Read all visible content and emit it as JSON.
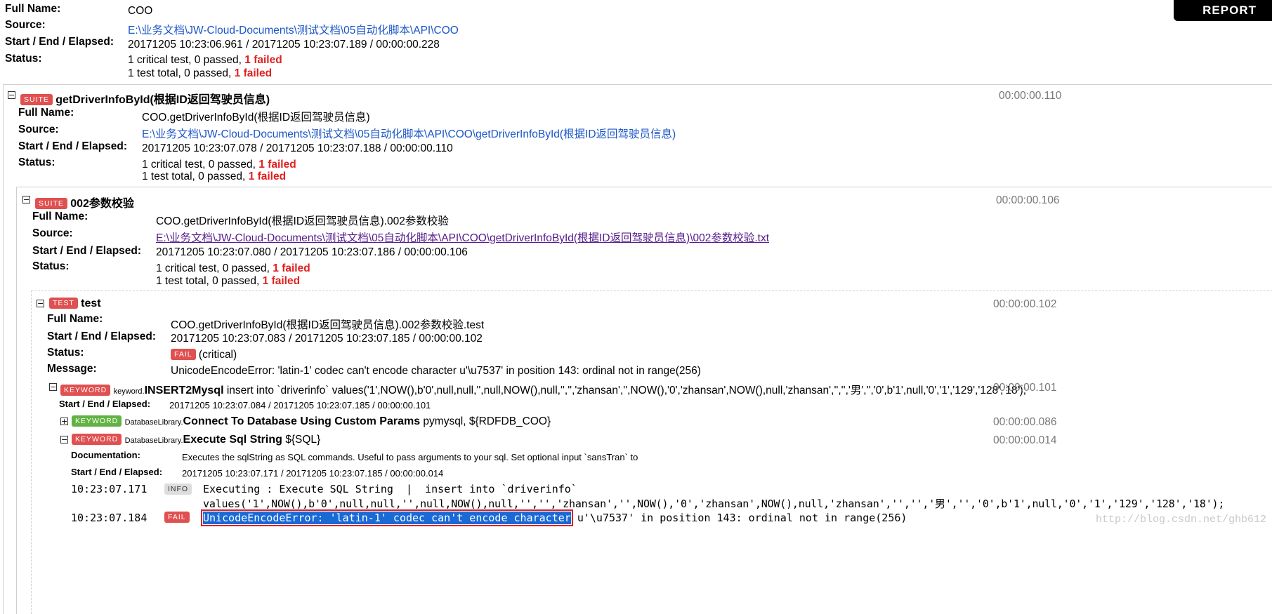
{
  "header": {
    "report_label": "REPORT",
    "full_name_label": "Full Name:",
    "full_name": "COO",
    "source_label": "Source:",
    "source": "E:\\业务文档\\JW-Cloud-Documents\\测试文档\\05自动化脚本\\API\\COO",
    "time_label": "Start / End / Elapsed:",
    "time": "20171205 10:23:06.961 / 20171205 10:23:07.189 / 00:00:00.228",
    "status_label": "Status:",
    "status_line1_prefix": "1 critical test, 0 passed, ",
    "status_line1_fail": "1 failed",
    "status_line2_prefix": "1 test total, 0 passed, ",
    "status_line2_fail": "1 failed"
  },
  "suite1": {
    "toggle": "−",
    "badge": "SUITE",
    "name": "getDriverInfoById(根据ID返回驾驶员信息)",
    "elapsed": "00:00:00.110",
    "full_name_label": "Full Name:",
    "full_name": "COO.getDriverInfoById(根据ID返回驾驶员信息)",
    "source_label": "Source:",
    "source": "E:\\业务文档\\JW-Cloud-Documents\\测试文档\\05自动化脚本\\API\\COO\\getDriverInfoById(根据ID返回驾驶员信息)",
    "time_label": "Start / End / Elapsed:",
    "time": "20171205 10:23:07.078 / 20171205 10:23:07.188 / 00:00:00.110",
    "status_label": "Status:",
    "status_line1_prefix": "1 critical test, 0 passed, ",
    "status_line1_fail": "1 failed",
    "status_line2_prefix": "1 test total, 0 passed, ",
    "status_line2_fail": "1 failed"
  },
  "suite2": {
    "toggle": "−",
    "badge": "SUITE",
    "name": "002参数校验",
    "elapsed": "00:00:00.106",
    "full_name_label": "Full Name:",
    "full_name": "COO.getDriverInfoById(根据ID返回驾驶员信息).002参数校验",
    "source_label": "Source:",
    "source": "E:\\业务文档\\JW-Cloud-Documents\\测试文档\\05自动化脚本\\API\\COO\\getDriverInfoById(根据ID返回驾驶员信息)\\002参数校验.txt",
    "time_label": "Start / End / Elapsed:",
    "time": "20171205 10:23:07.080 / 20171205 10:23:07.186 / 00:00:00.106",
    "status_label": "Status:",
    "status_line1_prefix": "1 critical test, 0 passed, ",
    "status_line1_fail": "1 failed",
    "status_line2_prefix": "1 test total, 0 passed, ",
    "status_line2_fail": "1 failed"
  },
  "test": {
    "toggle": "−",
    "badge": "TEST",
    "name": "test",
    "elapsed": "00:00:00.102",
    "full_name_label": "Full Name:",
    "full_name": "COO.getDriverInfoById(根据ID返回驾驶员信息).002参数校验.test",
    "time_label": "Start / End / Elapsed:",
    "time": "20171205 10:23:07.083 / 20171205 10:23:07.185 / 00:00:00.102",
    "status_label": "Status:",
    "status_badge": "FAIL",
    "status_text": "(critical)",
    "message_label": "Message:",
    "message": "UnicodeEncodeError: 'latin-1' codec can't encode character u'\\u7537' in position 143: ordinal not in range(256)"
  },
  "kw1": {
    "toggle": "−",
    "badge": "KEYWORD",
    "lib": "keyword.",
    "name": "INSERT2Mysql",
    "args": "insert into `driverinfo` values('1',NOW(),b'0',null,null,'',null,NOW(),null,'','','zhansan','',NOW(),'0','zhansan',NOW(),null,'zhansan','','','男','','0',b'1',null,'0','1','129','128','18');",
    "elapsed": "00:00:00.101",
    "time_label": "Start / End / Elapsed:",
    "time": "20171205 10:23:07.084 / 20171205 10:23:07.185 / 00:00:00.101"
  },
  "kw2": {
    "toggle": "+",
    "badge": "KEYWORD",
    "lib": "DatabaseLibrary.",
    "name": "Connect To Database Using Custom Params",
    "args": "pymysql, ${RDFDB_COO}",
    "elapsed": "00:00:00.086"
  },
  "kw3": {
    "toggle": "−",
    "badge": "KEYWORD",
    "lib": "DatabaseLibrary.",
    "name": "Execute Sql String",
    "args": "${SQL}",
    "elapsed": "00:00:00.014",
    "doc_label": "Documentation:",
    "doc": "Executes the sqlString as SQL commands. Useful to pass arguments to your sql. Set optional input `sansTran` to",
    "time_label": "Start / End / Elapsed:",
    "time": "20171205 10:23:07.171 / 20171205 10:23:07.185 / 00:00:00.014"
  },
  "log": [
    {
      "timestamp": "10:23:07.171",
      "level": "INFO",
      "line1": "Executing : Execute SQL String  |  insert into `driverinfo`",
      "line2": "values('1',NOW(),b'0',null,null,'',null,NOW(),null,'','','zhansan','',NOW(),'0','zhansan',NOW(),null,'zhansan','','','男','','0',b'1',null,'0','1','129','128','18');"
    },
    {
      "timestamp": "10:23:07.184",
      "level": "FAIL",
      "selected_text": "UnicodeEncodeError: 'latin-1' codec can't encode character",
      "rest_text": " u'\\u7537' in position 143: ordinal not in range(256)"
    }
  ],
  "watermark": "http://blog.csdn.net/ghb612",
  "colors": {
    "fail_red": "#e02020",
    "badge_red": "#e05050",
    "badge_green": "#61b243",
    "link_blue": "#1a55c8"
  }
}
